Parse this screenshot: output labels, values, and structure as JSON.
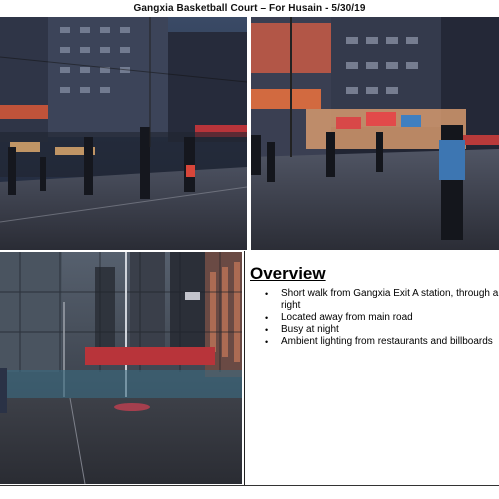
{
  "document": {
    "title": "Gangxia Basketball Court – For Husain - 5/30/19"
  },
  "photos": [
    {
      "name": "night-court-photo-1"
    },
    {
      "name": "night-court-photo-2"
    },
    {
      "name": "night-court-photo-3"
    }
  ],
  "overview": {
    "heading": "Overview",
    "bullets": [
      "Short walk from Gangxia Exit A station, through and on right",
      "Located away from main road",
      "Busy at night",
      "Ambient lighting from restaurants and billboards"
    ]
  }
}
